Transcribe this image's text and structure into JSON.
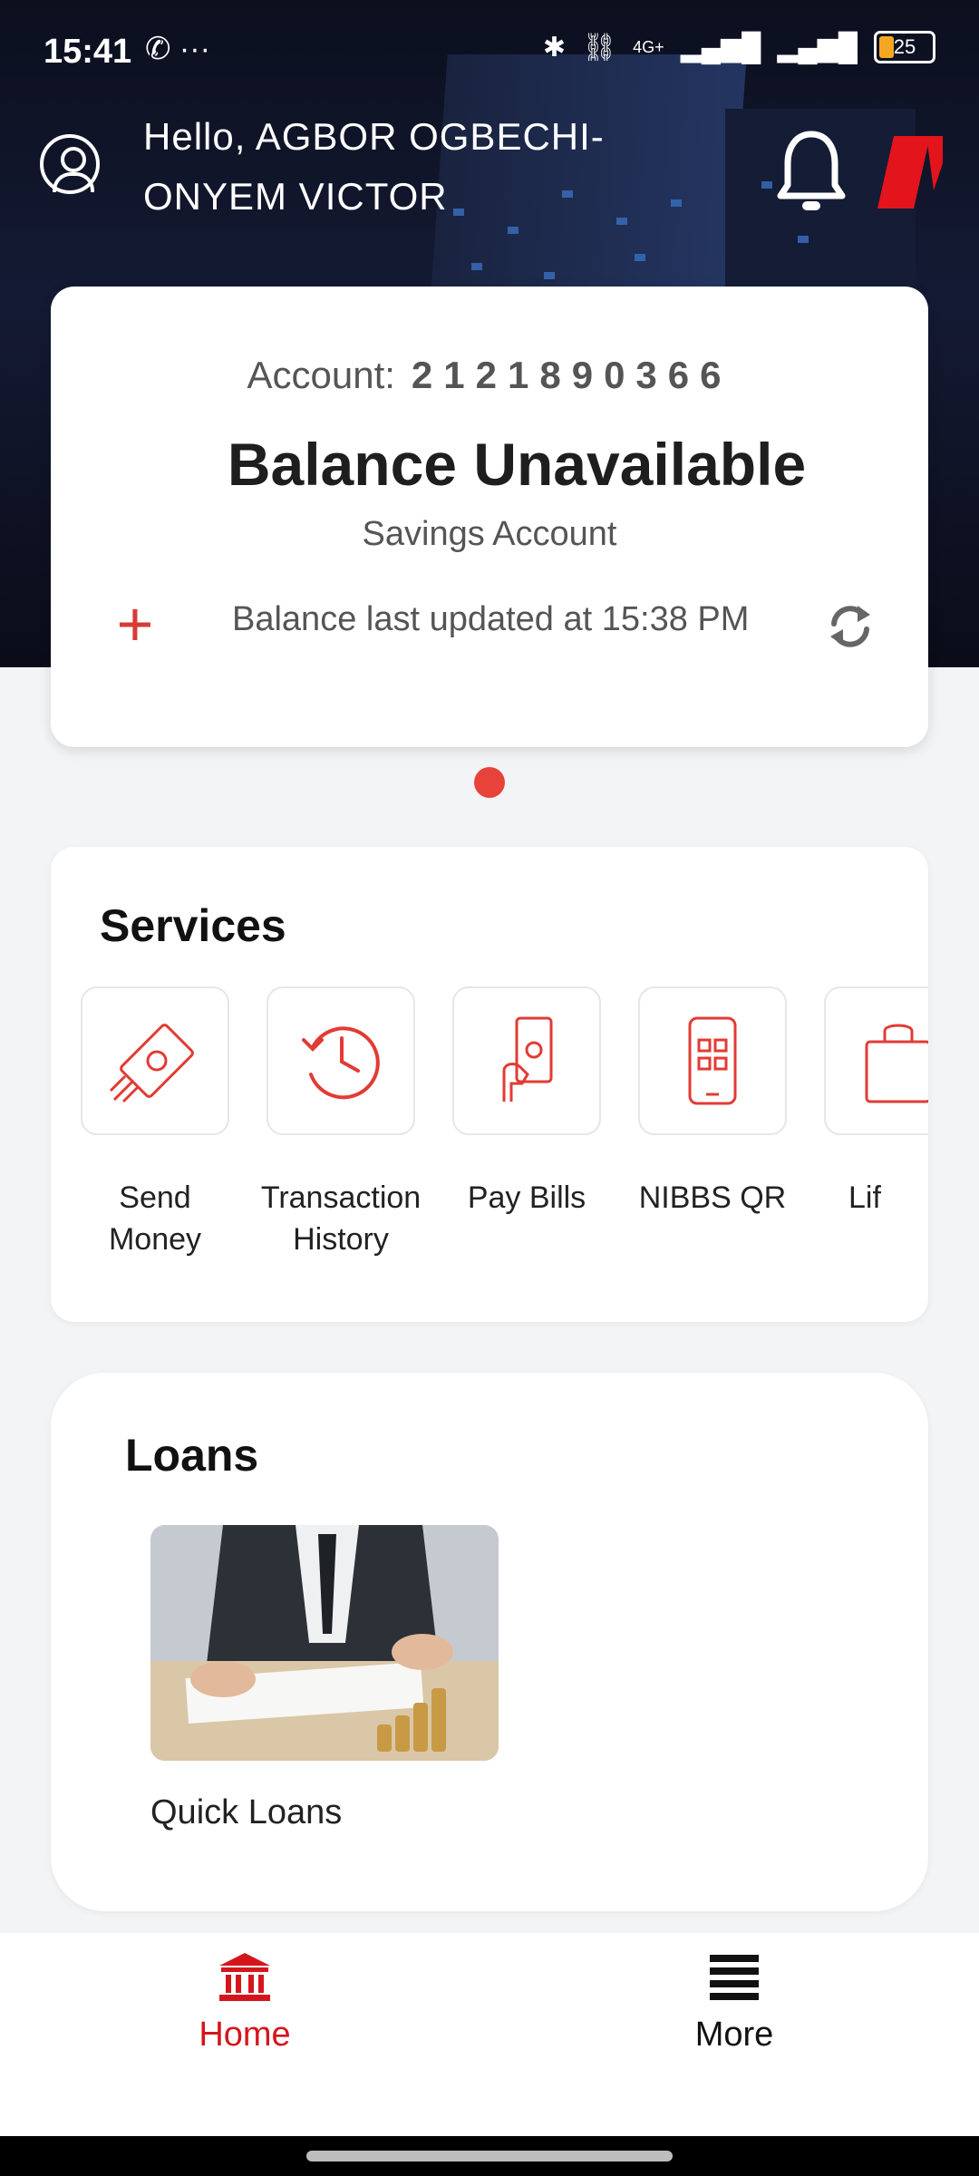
{
  "status_bar": {
    "time": "15:41",
    "left_icons": "✆ ···",
    "network_label": "4G+",
    "battery": "25"
  },
  "header": {
    "greeting": "Hello, AGBOR OGBECHI-ONYEM VICTOR",
    "icons": [
      "user-icon",
      "bell-icon",
      "brand-logo"
    ]
  },
  "account_card": {
    "account_label": "Account:",
    "account_number": "2121890366",
    "balance": "Balance Unavailable",
    "account_type": "Savings Account",
    "updated_text": "Balance last updated at 15:38 PM",
    "add_symbol": "+"
  },
  "colors": {
    "accent": "#d63b35",
    "pager_dot": "#e8433a"
  },
  "services": {
    "title": "Services",
    "items": [
      {
        "label": "Send Money",
        "icon": "send-money-icon"
      },
      {
        "label": "Transaction History",
        "icon": "history-clock-icon"
      },
      {
        "label": "Pay Bills",
        "icon": "pay-bills-icon"
      },
      {
        "label": "NIBBS QR",
        "icon": "qr-phone-icon"
      },
      {
        "label": "Lif",
        "icon": "lifestyle-bag-icon"
      }
    ]
  },
  "loans": {
    "title": "Loans",
    "items": [
      {
        "label": "Quick Loans"
      }
    ]
  },
  "nav": {
    "home": "Home",
    "more": "More"
  }
}
